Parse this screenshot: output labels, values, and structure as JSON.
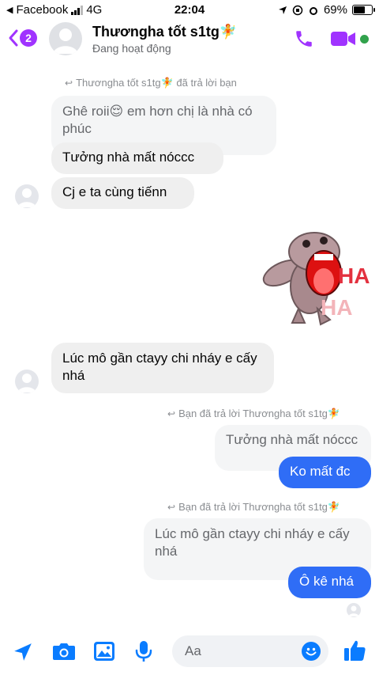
{
  "status_bar": {
    "back_app": "Facebook",
    "network": "4G",
    "time": "22:04",
    "battery_text": "69%",
    "battery_level": 0.69
  },
  "header": {
    "back_count": "2",
    "contact_name": "Thươngha tốt s1tg🧚",
    "contact_status": "Đang hoạt động"
  },
  "messages": {
    "reply_note_1": "Thươngha tốt s1tg🧚 đã trả lời bạn",
    "quoted_1": "Ghê roii😌 em hơn chị là nhà có phúc",
    "msg_1": "Tưởng nhà mất nóccc",
    "msg_2": "Cj e ta cùng tiếnn",
    "sticker_text_1": "HA",
    "sticker_text_2": "HA",
    "msg_3": "Lúc mô gần ctayy chi nháy e cấy nhá",
    "reply_note_2": "Bạn đã trả lời Thươngha tốt s1tg🧚",
    "quoted_2": "Tưởng nhà mất nóccc",
    "msg_4": "Ko mất đc",
    "reply_note_3": "Bạn đã trả lời Thươngha tốt s1tg🧚",
    "quoted_3": "Lúc mô gần ctayy chi nháy e cấy nhá",
    "msg_5": "Ô kê nhá"
  },
  "composer": {
    "placeholder": "Aa"
  },
  "colors": {
    "accent": "#a033ff",
    "outgoing_bubble": "#2f6df6",
    "composer_icons": "#0a7cff",
    "online": "#31a24c"
  },
  "icons": {
    "back": "chevron-left-icon",
    "call": "phone-icon",
    "video": "video-camera-icon",
    "location": "location-arrow-icon",
    "camera": "camera-icon",
    "gallery": "image-icon",
    "mic": "microphone-icon",
    "emoji": "smiley-icon",
    "like": "thumbs-up-icon"
  }
}
